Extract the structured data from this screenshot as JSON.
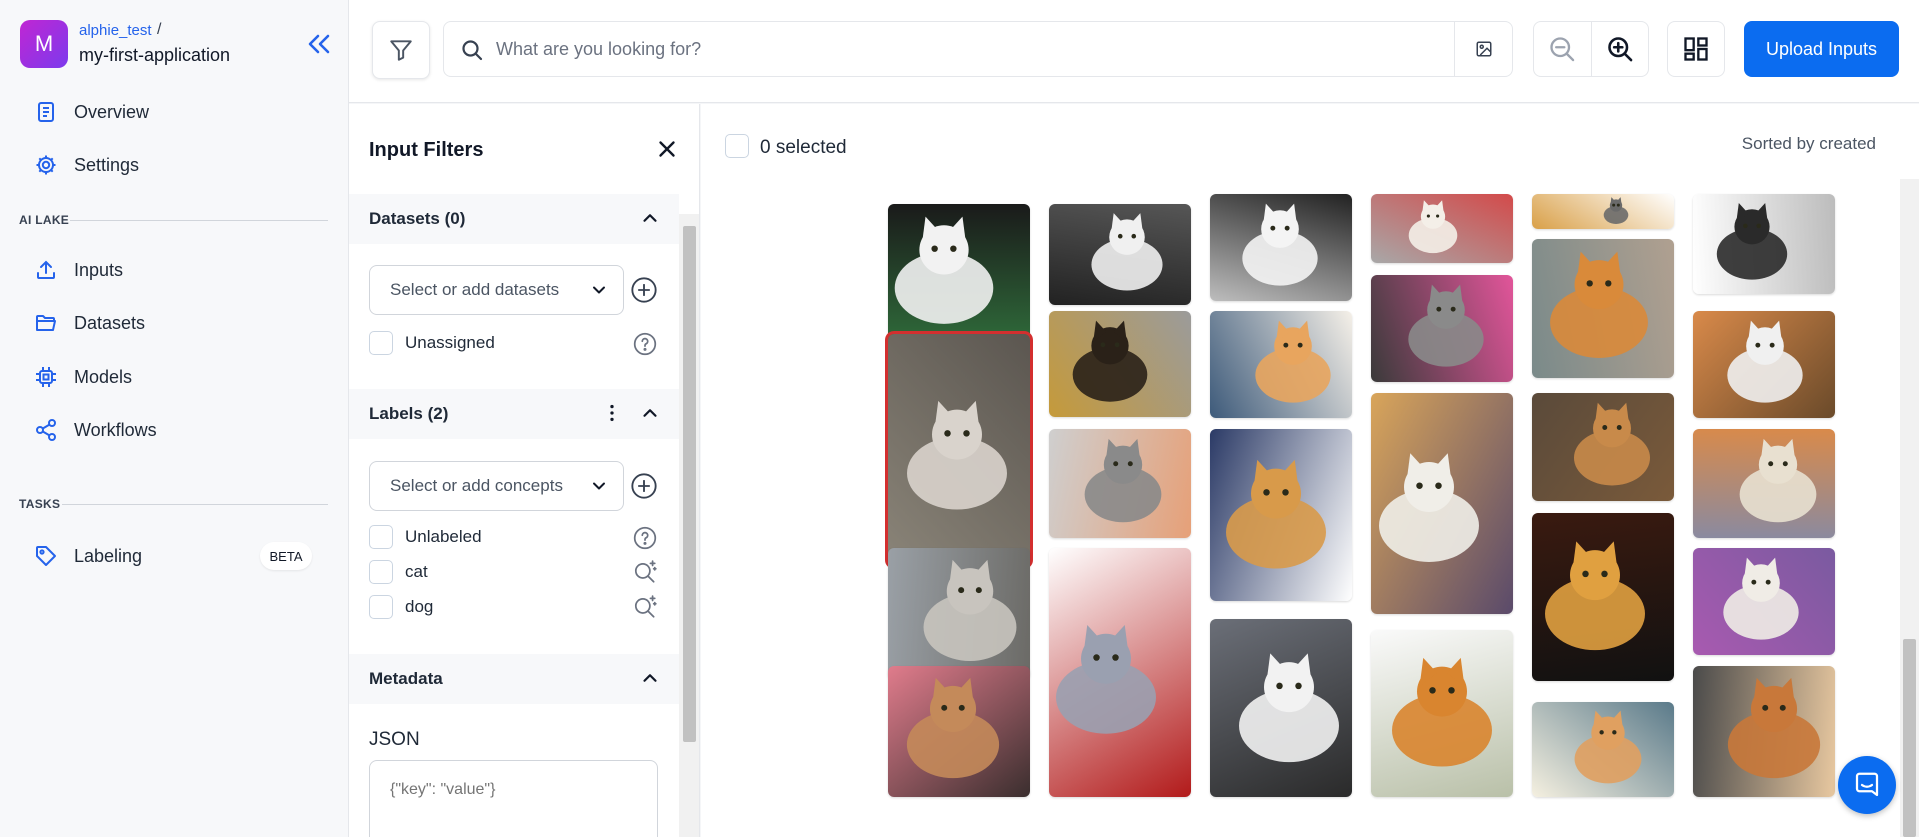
{
  "sidebar": {
    "avatar_letter": "M",
    "username": "alphie_test",
    "slash": "/",
    "app_name": "my-first-application",
    "nav_top": [
      {
        "label": "Overview",
        "icon": "document-icon"
      },
      {
        "label": "Settings",
        "icon": "gear-icon"
      }
    ],
    "section_ai_lake": "AI LAKE",
    "nav_ai_lake": [
      {
        "label": "Inputs",
        "icon": "upload-icon"
      },
      {
        "label": "Datasets",
        "icon": "folder-icon"
      },
      {
        "label": "Models",
        "icon": "chip-icon"
      },
      {
        "label": "Workflows",
        "icon": "share-icon"
      }
    ],
    "section_tasks": "TASKS",
    "nav_tasks": [
      {
        "label": "Labeling",
        "icon": "tag-icon",
        "badge": "BETA"
      }
    ]
  },
  "topbar": {
    "search_placeholder": "What are you looking for?",
    "upload_label": "Upload Inputs"
  },
  "filters": {
    "title": "Input Filters",
    "datasets": {
      "header": "Datasets (0)",
      "select_placeholder": "Select or add datasets",
      "options": [
        "Unassigned"
      ]
    },
    "labels": {
      "header": "Labels (2)",
      "select_placeholder": "Select or add concepts",
      "options": [
        "Unlabeled",
        "cat",
        "dog"
      ]
    },
    "metadata": {
      "header": "Metadata",
      "json_label": "JSON",
      "json_placeholder": "{\"key\": \"value\"}"
    }
  },
  "gallery": {
    "selected_text": "0 selected",
    "sort_text": "Sorted by created",
    "colors": {
      "selected_outline": "#d32f2f",
      "accent": "#0b6cf0"
    },
    "images": [
      {
        "subject": "cat",
        "palette": [
          "#2f6b3a",
          "#f2f2f2",
          "#1a1a1a"
        ]
      },
      {
        "subject": "cat",
        "palette": [
          "#8a8478",
          "#d9d3cc",
          "#5b5650"
        ],
        "selected": true
      },
      {
        "subject": "cat",
        "palette": [
          "#9aa0a6",
          "#c8c4be",
          "#6b6a66"
        ]
      },
      {
        "subject": "cat",
        "palette": [
          "#e07c8c",
          "#c48a5a",
          "#3a2e2e"
        ]
      },
      {
        "subject": "cat",
        "palette": [
          "#565656",
          "#f0f0f0",
          "#222222"
        ]
      },
      {
        "subject": "cat",
        "palette": [
          "#9b9b9b",
          "#2a2118",
          "#c59a3a"
        ]
      },
      {
        "subject": "cat",
        "palette": [
          "#e6a078",
          "#8a8a8a",
          "#cfcfcf"
        ]
      },
      {
        "subject": "cat",
        "palette": [
          "#b21a1a",
          "#9aa0b0",
          "#ffffff"
        ]
      },
      {
        "subject": "cat",
        "palette": [
          "#bdbdbd",
          "#f4f4f4",
          "#222222"
        ]
      },
      {
        "subject": "cat",
        "palette": [
          "#3d5a7a",
          "#e8a55e",
          "#f5f0e8"
        ]
      },
      {
        "subject": "cat",
        "palette": [
          "#2b3a66",
          "#d89a4a",
          "#ffffff"
        ]
      },
      {
        "subject": "cat",
        "palette": [
          "#6b6f78",
          "#f2f2f2",
          "#2a2a2a"
        ]
      },
      {
        "subject": "cat",
        "palette": [
          "#d34a4a",
          "#f4efe8",
          "#a8a8a8"
        ]
      },
      {
        "subject": "cat",
        "palette": [
          "#e2559a",
          "#8a8a8a",
          "#3a3a3a"
        ]
      },
      {
        "subject": "cat",
        "palette": [
          "#5a4a6a",
          "#f0eee8",
          "#d9a55a"
        ]
      },
      {
        "subject": "cat",
        "palette": [
          "#b9c0a8",
          "#d9852f",
          "#fafafa"
        ]
      },
      {
        "subject": "cat",
        "palette": [
          "#d9a048",
          "#6a6a6a",
          "#ffffff"
        ]
      },
      {
        "subject": "cat",
        "palette": [
          "#7a8a8a",
          "#d98a3a",
          "#b0a090"
        ]
      },
      {
        "subject": "cat",
        "palette": [
          "#5a4a3a",
          "#c88a4a",
          "#7a5a3a"
        ]
      },
      {
        "subject": "cat",
        "palette": [
          "#3a1a10",
          "#e0a040",
          "#111111"
        ]
      },
      {
        "subject": "cat",
        "palette": [
          "#5a7a8a",
          "#e0a060",
          "#f5f0e0"
        ]
      },
      {
        "subject": "cat",
        "palette": [
          "#bcbcbc",
          "#2a2a2a",
          "#ffffff"
        ]
      },
      {
        "subject": "cat",
        "palette": [
          "#6a4a2a",
          "#f0f0f0",
          "#d98a4a"
        ]
      },
      {
        "subject": "cat",
        "palette": [
          "#8a8aa0",
          "#e8e0d0",
          "#d98a4a"
        ]
      },
      {
        "subject": "cat",
        "palette": [
          "#a85ab0",
          "#f0ece6",
          "#7a5aa0"
        ]
      },
      {
        "subject": "cat",
        "palette": [
          "#4a4a4a",
          "#c8783a",
          "#e8c8a0"
        ]
      },
      {
        "subject": "cat",
        "palette": [
          "#b8a898",
          "#ffffff",
          "#6a5a4a"
        ]
      }
    ]
  }
}
